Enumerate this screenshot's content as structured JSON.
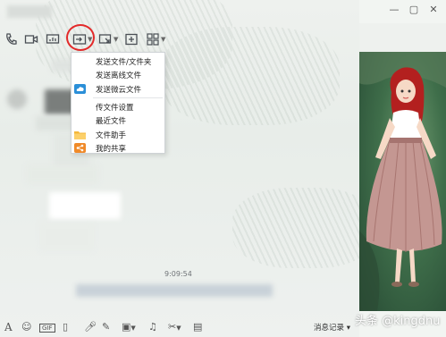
{
  "window": {
    "controls": [
      "minimize",
      "maximize",
      "close"
    ]
  },
  "toolbar": {
    "buttons": [
      {
        "name": "voice-call-button",
        "icon": "phone-icon"
      },
      {
        "name": "video-call-button",
        "icon": "video-icon"
      },
      {
        "name": "share-screen-button",
        "icon": "screen-icon"
      },
      {
        "name": "send-file-button",
        "icon": "folder-send-icon",
        "has_menu": true
      },
      {
        "name": "remote-desktop-button",
        "icon": "remote-icon",
        "has_menu": true
      },
      {
        "name": "create-group-button",
        "icon": "add-icon"
      },
      {
        "name": "apps-button",
        "icon": "grid-icon",
        "has_menu": true
      }
    ]
  },
  "file_menu": {
    "items": [
      {
        "label": "发送文件/文件夹",
        "icon": ""
      },
      {
        "label": "发送离线文件",
        "icon": ""
      },
      {
        "label": "发送微云文件",
        "icon": "cloud-icon"
      },
      {
        "label": "传文件设置",
        "icon": ""
      },
      {
        "label": "最近文件",
        "icon": ""
      },
      {
        "label": "文件助手",
        "icon": "folder-icon"
      },
      {
        "label": "我的共享",
        "icon": "share-icon"
      }
    ]
  },
  "chat": {
    "timestamp": "9:09:54"
  },
  "bottom_bar": {
    "tools": [
      "font-icon",
      "emoji-icon",
      "gif-icon",
      "vibrate-icon",
      "mic-icon",
      "pen-icon",
      "image-icon",
      "music-icon",
      "scissors-icon",
      "red-packet-icon"
    ],
    "history_label": "消息记录"
  },
  "watermark": {
    "text": "头条 @kingdnu"
  },
  "colors": {
    "highlight_circle": "#e32a2a",
    "menu_bg": "#ffffff",
    "cloud_blue": "#2b8fd8",
    "folder_yellow": "#f5b73b",
    "share_orange": "#f08a2a"
  }
}
